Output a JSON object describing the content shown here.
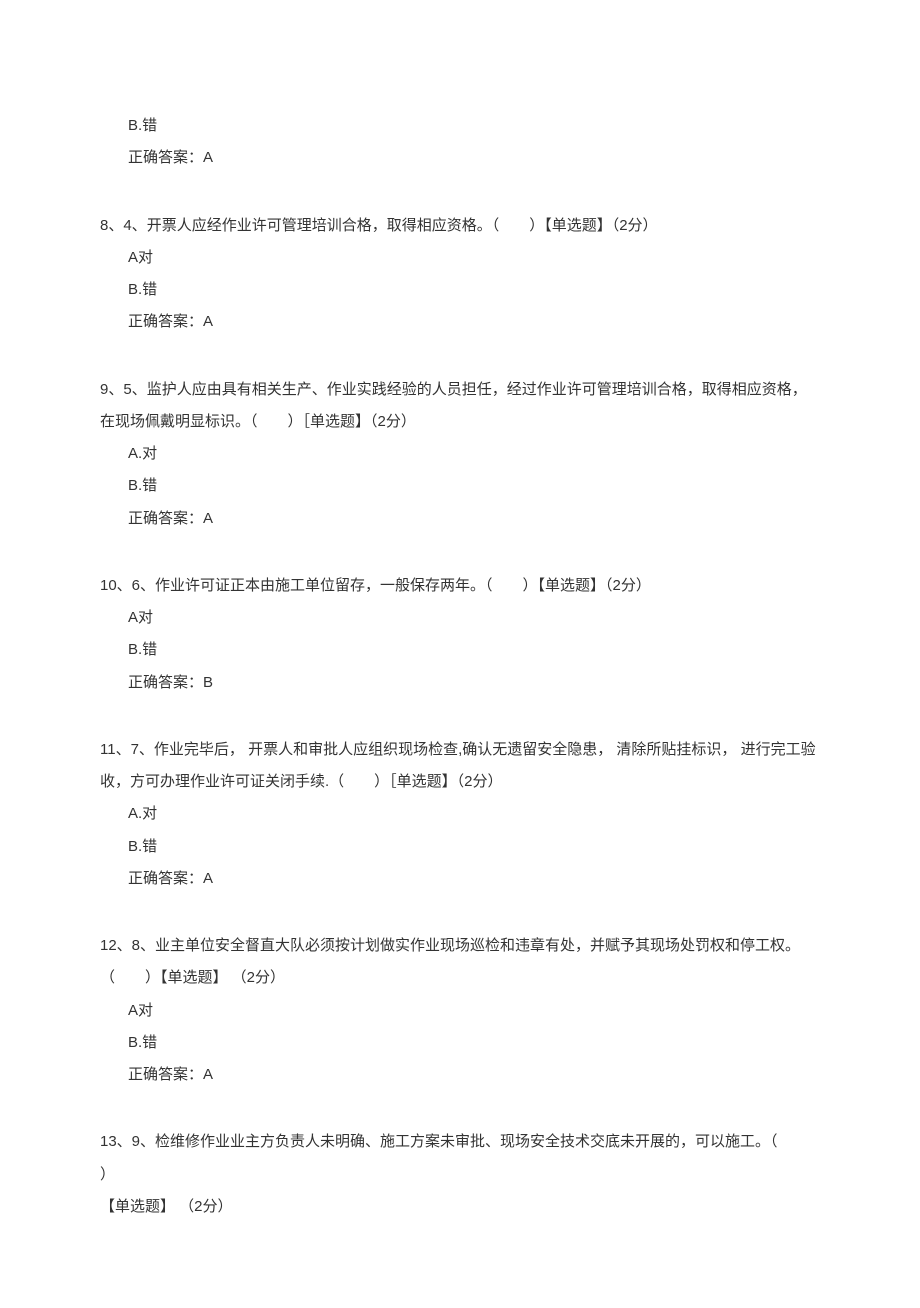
{
  "continuation": {
    "optionB": "B.错",
    "answer": "正确答案：A"
  },
  "questions": [
    {
      "number": "8、4、",
      "text": "开票人应经作业许可管理培训合格，取得相应资格。（　　）【单选题】（2分）",
      "optionA": "A对",
      "optionB": "B.错",
      "answer": "正确答案：A"
    },
    {
      "number": "9、5、",
      "text": "监护人应由具有相关生产、作业实践经验的人员担任，经过作业许可管理培训合格，取得相应资格，在现场佩戴明显标识。（　　）［单选题】（2分）",
      "optionA": "A.对",
      "optionB": "B.错",
      "answer": "正确答案：A"
    },
    {
      "number": "10、6、",
      "text": "作业许可证正本由施工单位留存，一般保存两年。（　　）【单选题】（2分）",
      "optionA": "A对",
      "optionB": "B.错",
      "answer": "正确答案：B"
    },
    {
      "number": "11、7、",
      "text": "作业完毕后， 开票人和审批人应组织现场检查,确认无遗留安全隐患， 清除所贴挂标识， 进行完工验收，方可办理作业许可证关闭手续.（　　）［单选题】（2分）",
      "optionA": "A.对",
      "optionB": "B.错",
      "answer": "正确答案：A"
    },
    {
      "number": "12、8、",
      "text": "业主单位安全督直大队必须按计划做实作业现场巡检和违章有处，并赋予其现场处罚权和停工权。（　　）【单选题】 （2分）",
      "optionA": "A对",
      "optionB": "B.错",
      "answer": "正确答案：A"
    },
    {
      "number": "13、9、",
      "text": "检维修作业业主方负责人未明确、施工方案未审批、现场安全技术交底未开展的，可以施工。（",
      "line2": "）",
      "line3": "【单选题】 （2分）"
    }
  ]
}
